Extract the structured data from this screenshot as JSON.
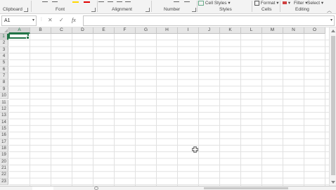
{
  "ribbon": {
    "top_items": {
      "cell_styles": "Cell Styles",
      "format": "Format",
      "filter": "Filter",
      "select": "Select"
    },
    "groups": [
      {
        "label": "Clipboard"
      },
      {
        "label": "Font"
      },
      {
        "label": "Alignment"
      },
      {
        "label": "Number"
      },
      {
        "label": "Styles"
      },
      {
        "label": "Cells"
      },
      {
        "label": "Editing"
      }
    ],
    "font_color_swatches": {
      "highlight": "#ffd800",
      "font_color": "#e00000"
    }
  },
  "formula_bar": {
    "name_box": "A1",
    "cancel_symbol": "✕",
    "enter_symbol": "✓",
    "fx_symbol": "fx",
    "formula_value": ""
  },
  "grid": {
    "columns": [
      "A",
      "B",
      "C",
      "D",
      "E",
      "F",
      "G",
      "H",
      "I",
      "J",
      "K",
      "L",
      "M",
      "N",
      "O"
    ],
    "rows": [
      "1",
      "2",
      "3",
      "4",
      "5",
      "6",
      "7",
      "8",
      "9",
      "10",
      "11",
      "12",
      "13",
      "14",
      "15",
      "16",
      "17",
      "18",
      "19",
      "20",
      "21",
      "22",
      "23"
    ],
    "active_cell": "A1",
    "accent": "#217346"
  }
}
